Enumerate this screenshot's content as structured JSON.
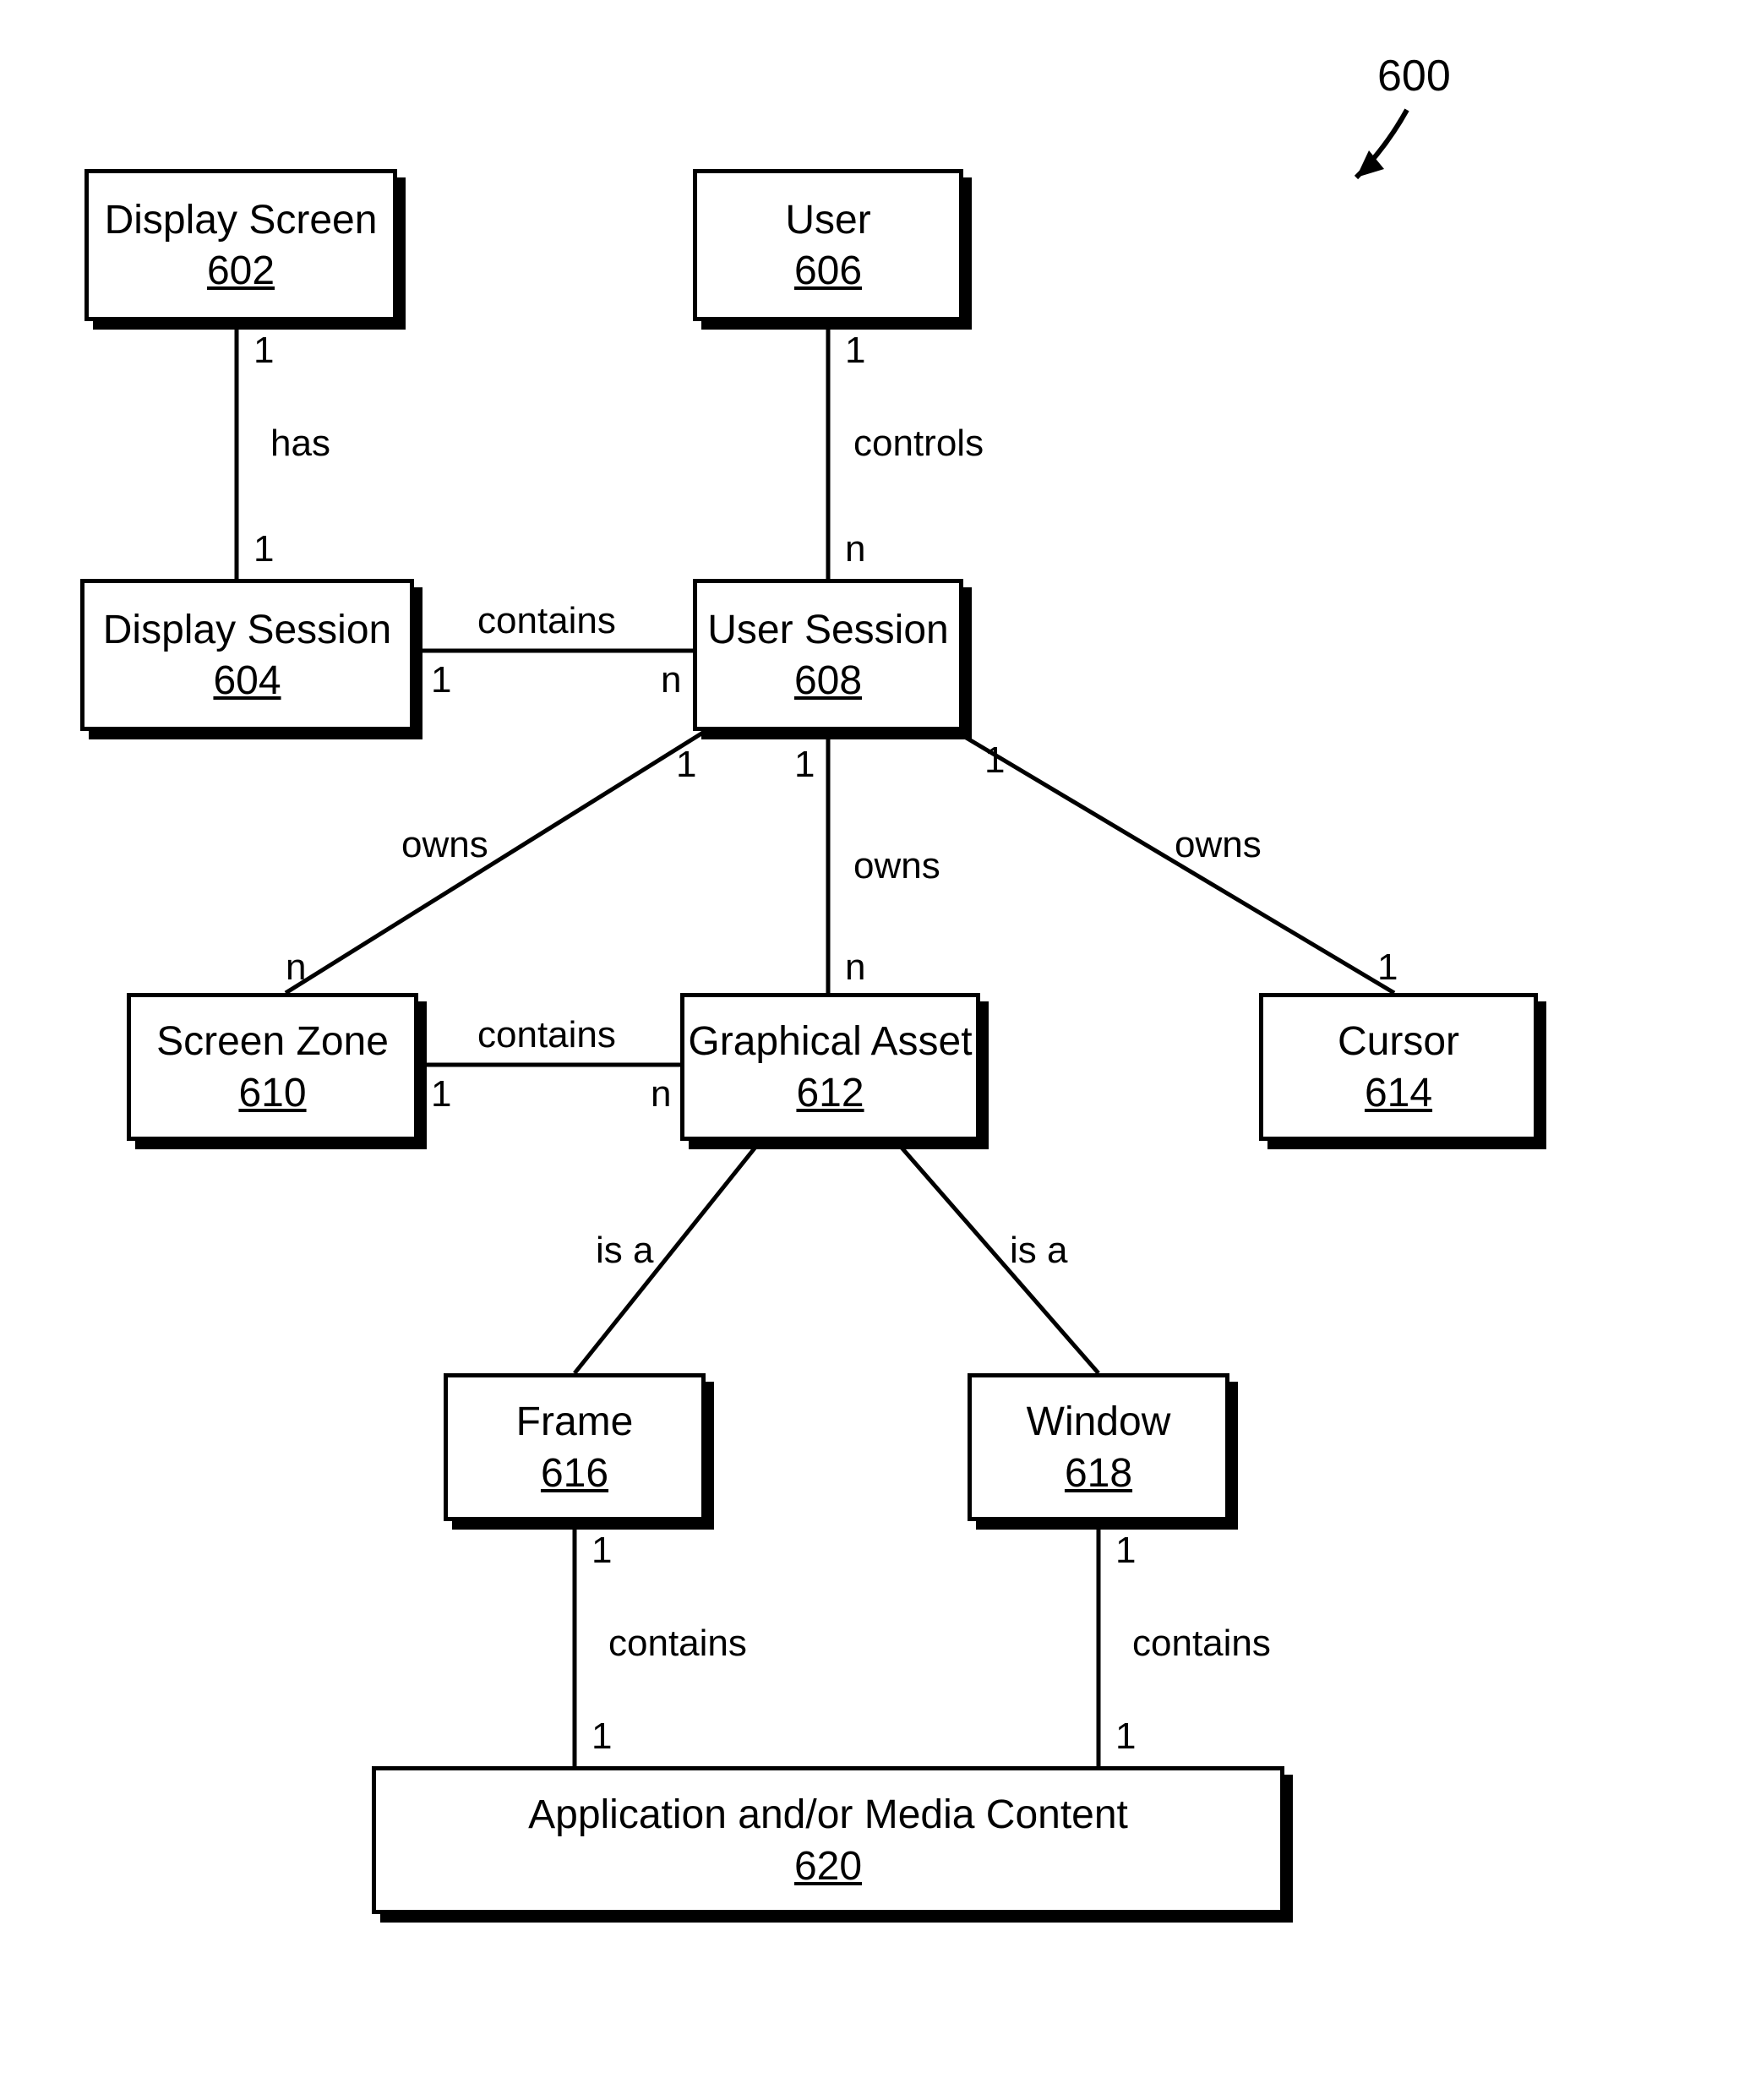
{
  "figure_label": "600",
  "boxes": {
    "display_screen": {
      "title": "Display Screen",
      "ref": "602"
    },
    "display_session": {
      "title": "Display Session",
      "ref": "604"
    },
    "user": {
      "title": "User",
      "ref": "606"
    },
    "user_session": {
      "title": "User Session",
      "ref": "608"
    },
    "screen_zone": {
      "title": "Screen Zone",
      "ref": "610"
    },
    "graphical_asset": {
      "title": "Graphical Asset",
      "ref": "612"
    },
    "cursor": {
      "title": "Cursor",
      "ref": "614"
    },
    "frame": {
      "title": "Frame",
      "ref": "616"
    },
    "window": {
      "title": "Window",
      "ref": "618"
    },
    "app_media": {
      "title": "Application and/or Media Content",
      "ref": "620"
    }
  },
  "edges": {
    "ds_dsess": {
      "label": "has",
      "c1": "1",
      "c2": "1"
    },
    "u_usess": {
      "label": "controls",
      "c1": "1",
      "c2": "n"
    },
    "dsess_usess": {
      "label": "contains",
      "c1": "1",
      "c2": "n"
    },
    "usess_sz": {
      "label": "owns",
      "c1": "1",
      "c2": "n"
    },
    "usess_ga": {
      "label": "owns",
      "c1": "1",
      "c2": "n"
    },
    "usess_cur": {
      "label": "owns",
      "c1": "1",
      "c2": "1"
    },
    "sz_ga": {
      "label": "contains",
      "c1": "1",
      "c2": "n"
    },
    "ga_frame": {
      "label": "is a"
    },
    "ga_window": {
      "label": "is a"
    },
    "frame_app": {
      "label": "contains",
      "c1": "1",
      "c2": "1"
    },
    "window_app": {
      "label": "contains",
      "c1": "1",
      "c2": "1"
    }
  }
}
